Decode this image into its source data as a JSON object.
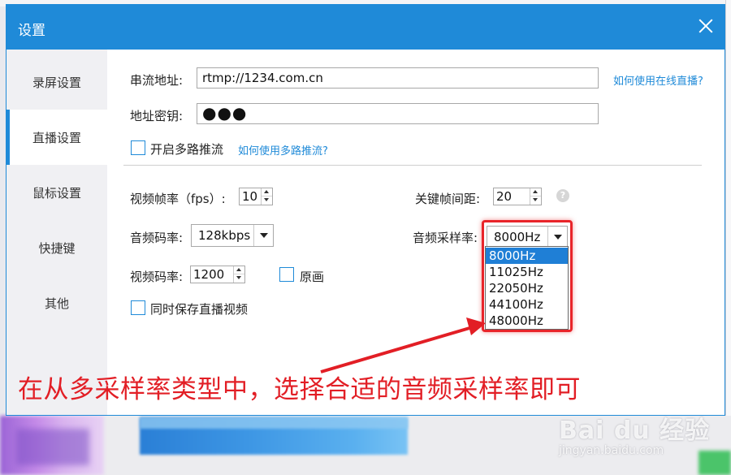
{
  "window": {
    "title": "设置",
    "close_icon": "close-icon"
  },
  "sidebar": {
    "items": [
      {
        "label": "录屏设置",
        "active": false
      },
      {
        "label": "直播设置",
        "active": true
      },
      {
        "label": "鼠标设置",
        "active": false
      },
      {
        "label": "快捷键",
        "active": false
      },
      {
        "label": "其他",
        "active": false
      }
    ]
  },
  "stream": {
    "url_label": "串流地址:",
    "url_value": "rtmp://1234.com.cn",
    "url_help_link": "如何使用在线直播?",
    "key_label": "地址密钥:",
    "key_value": "●●●",
    "multi_push_label": "开启多路推流",
    "multi_push_checked": false,
    "multi_push_help_link": "如何使用多路推流?"
  },
  "video": {
    "fps_label": "视频帧率（fps）:",
    "fps_value": "10",
    "keyframe_label": "关键帧间距:",
    "keyframe_value": "20",
    "help_icon": "question-icon",
    "bitrate_label": "视频码率:",
    "bitrate_value": "1200",
    "original_label": "原画",
    "original_checked": false
  },
  "audio": {
    "bitrate_label": "音频码率:",
    "bitrate_value": "128kbps",
    "samplerate_label": "音频采样率:",
    "samplerate_value": "8000Hz",
    "samplerate_options": [
      "8000Hz",
      "11025Hz",
      "22050Hz",
      "44100Hz",
      "48000Hz"
    ],
    "samplerate_selected_index": 0
  },
  "save": {
    "label": "同时保存直播视频",
    "checked": false
  },
  "annotation": {
    "text": "在从多采样率类型中，选择合适的音频采样率即可",
    "color": "#e21e25"
  },
  "watermark": {
    "main": "Bai du 经验",
    "sub": "jingyan.baidu.com"
  },
  "colors": {
    "accent": "#1f8ad8",
    "highlight": "#1f7fd6"
  }
}
